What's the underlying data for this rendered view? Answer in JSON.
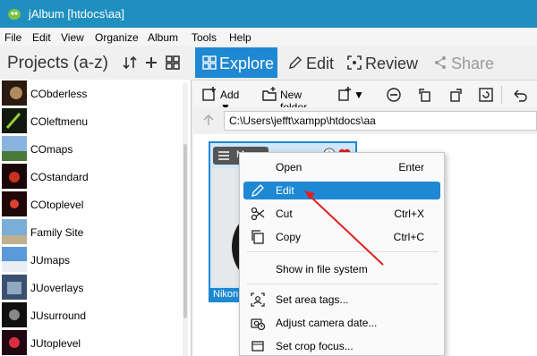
{
  "window": {
    "title": "jAlbum [htdocs\\aa]"
  },
  "menubar": [
    "File",
    "Edit",
    "View",
    "Organize",
    "Album",
    "Tools",
    "Help"
  ],
  "sidebar": {
    "title": "Projects (a-z)",
    "projects": [
      {
        "name": "CObderless"
      },
      {
        "name": "COleftmenu"
      },
      {
        "name": "COmaps"
      },
      {
        "name": "COstandard"
      },
      {
        "name": "COtoplevel"
      },
      {
        "name": "Family Site"
      },
      {
        "name": "JUmaps"
      },
      {
        "name": "JUoverlays"
      },
      {
        "name": "JUsurround"
      },
      {
        "name": "JUtoplevel"
      }
    ]
  },
  "tabs": [
    {
      "label": "Explore",
      "icon": "grid-icon",
      "active": true
    },
    {
      "label": "Edit",
      "icon": "pencil-icon",
      "active": false
    },
    {
      "label": "Review",
      "icon": "review-icon",
      "active": false
    },
    {
      "label": "Share",
      "icon": "share-icon",
      "active": false
    }
  ],
  "toolbar": {
    "add_label": "Add ▼",
    "new_folder_label": "New folder",
    "more_label": "▼"
  },
  "path": {
    "value": "C:\\Users\\jefft\\xampp\\htdocs\\aa"
  },
  "card": {
    "chip": "M",
    "caption": "Nikon D"
  },
  "context_menu": {
    "items": [
      {
        "label": "Open",
        "shortcut": "Enter",
        "icon": ""
      },
      {
        "label": "Edit",
        "shortcut": "",
        "icon": "pencil-icon",
        "highlighted": true
      },
      {
        "label": "Cut",
        "shortcut": "Ctrl+X",
        "icon": "scissors-icon"
      },
      {
        "label": "Copy",
        "shortcut": "Ctrl+C",
        "icon": "copy-icon"
      },
      {
        "label": "Show in file system",
        "shortcut": "",
        "icon": ""
      },
      {
        "label": "Set area tags...",
        "shortcut": "",
        "icon": "tag-area-icon"
      },
      {
        "label": "Adjust camera date...",
        "shortcut": "",
        "icon": "camera-date-icon"
      },
      {
        "label": "Set crop focus...",
        "shortcut": "",
        "icon": "crop-icon"
      }
    ]
  },
  "colors": {
    "accent": "#1e88d2",
    "titlebar": "#1f8fbf",
    "arrow": "#e02020"
  }
}
